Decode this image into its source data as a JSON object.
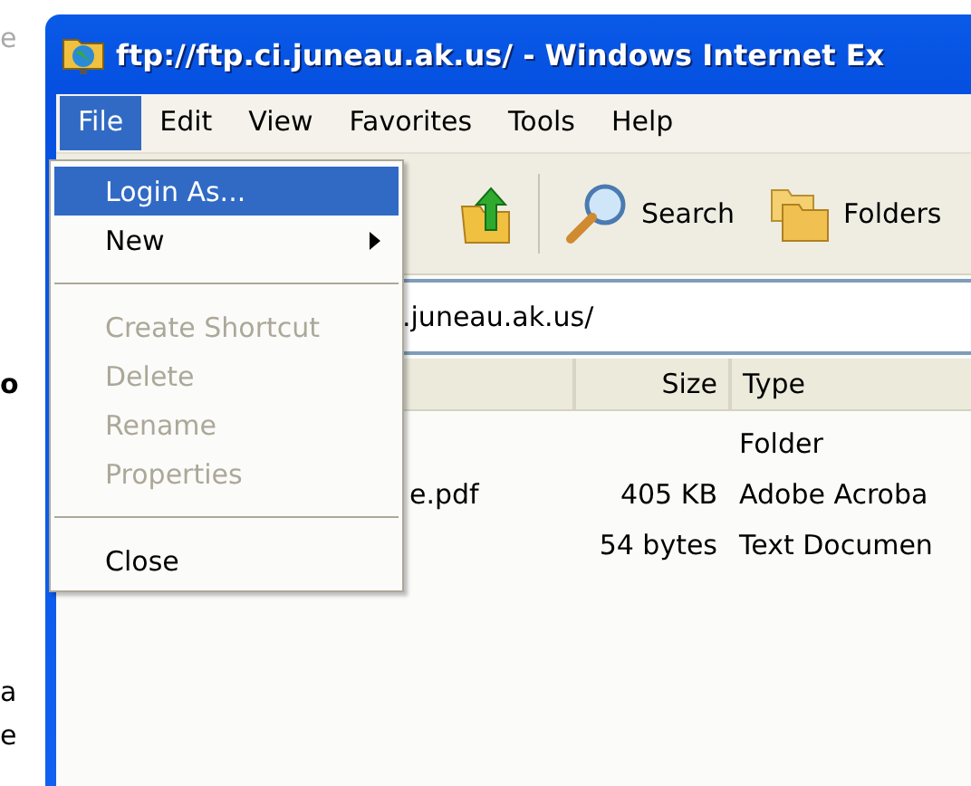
{
  "background_fragments": [
    {
      "text": "e",
      "greyed": true,
      "bold": false
    },
    {
      "text": "o",
      "greyed": false,
      "bold": true
    },
    {
      "text": "a",
      "greyed": false,
      "bold": false
    },
    {
      "text": "e",
      "greyed": false,
      "bold": false
    }
  ],
  "window": {
    "title": "ftp://ftp.ci.juneau.ak.us/ - Windows Internet Ex"
  },
  "menu_bar": [
    {
      "label": "File",
      "selected": true
    },
    {
      "label": "Edit",
      "selected": false
    },
    {
      "label": "View",
      "selected": false
    },
    {
      "label": "Favorites",
      "selected": false
    },
    {
      "label": "Tools",
      "selected": false
    },
    {
      "label": "Help",
      "selected": false
    }
  ],
  "toolbar": [
    {
      "kind": "up"
    },
    {
      "kind": "search",
      "label": "Search"
    },
    {
      "kind": "folders",
      "label": "Folders"
    }
  ],
  "address": {
    "value": ".juneau.ak.us/"
  },
  "columns": [
    "Size",
    "Type"
  ],
  "rows": [
    {
      "type": "Folder"
    },
    {
      "name": "e.pdf",
      "size": "405 KB",
      "type": "Adobe Acroba"
    },
    {
      "size": "54 bytes",
      "type": "Text Documen"
    }
  ],
  "file_menu": [
    {
      "kind": "item",
      "label": "Login As...",
      "selected": true,
      "disabled": false,
      "submenu": false
    },
    {
      "kind": "item",
      "label": "New",
      "selected": false,
      "disabled": false,
      "submenu": true
    },
    {
      "kind": "separator"
    },
    {
      "kind": "item",
      "label": "Create Shortcut",
      "selected": false,
      "disabled": true,
      "submenu": false
    },
    {
      "kind": "item",
      "label": "Delete",
      "selected": false,
      "disabled": true,
      "submenu": false
    },
    {
      "kind": "item",
      "label": "Rename",
      "selected": false,
      "disabled": true,
      "submenu": false
    },
    {
      "kind": "item",
      "label": "Properties",
      "selected": false,
      "disabled": true,
      "submenu": false
    },
    {
      "kind": "separator"
    },
    {
      "kind": "item",
      "label": "Close",
      "selected": false,
      "disabled": false,
      "submenu": false
    }
  ]
}
